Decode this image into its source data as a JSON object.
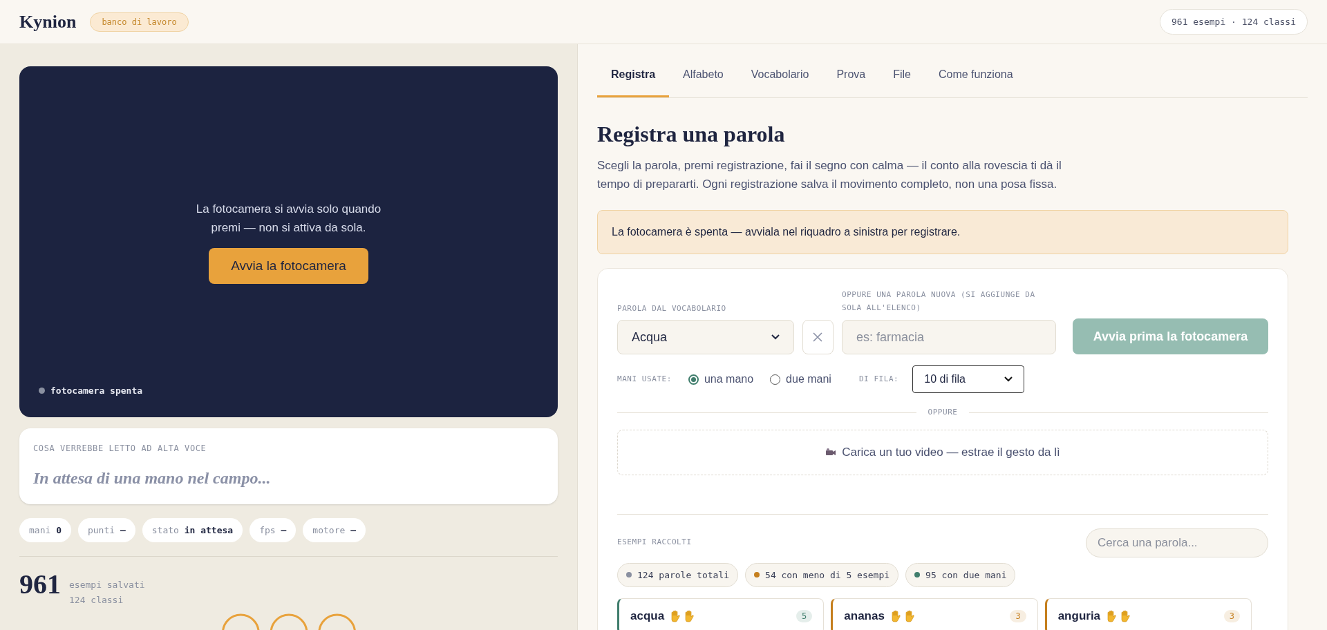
{
  "header": {
    "logo": "Kynion",
    "badge": "banco di lavoro",
    "summary": "961 esempi · 124 classi"
  },
  "camera": {
    "message": "La fotocamera si avvia solo quando premi — non si attiva da sola.",
    "button": "Avvia la fotocamera",
    "status": "fotocamera spenta",
    "on": false
  },
  "speech": {
    "label": "COSA VERREBBE LETTO AD ALTA VOCE",
    "text": "In attesa di una mano nel campo..."
  },
  "stats": [
    {
      "label": "mani",
      "value": "0"
    },
    {
      "label": "punti",
      "value": "—"
    },
    {
      "label": "stato",
      "value": "in attesa"
    },
    {
      "label": "fps",
      "value": "—"
    },
    {
      "label": "motore",
      "value": "—"
    }
  ],
  "totals": {
    "count": "961",
    "line_1": "esempi salvati",
    "line_2": "124 classi"
  },
  "tabs": [
    {
      "label": "Registra",
      "selected": true
    },
    {
      "label": "Alfabeto",
      "selected": false
    },
    {
      "label": "Vocabolario",
      "selected": false
    },
    {
      "label": "Prova",
      "selected": false
    },
    {
      "label": "File",
      "selected": false
    },
    {
      "label": "Come funziona",
      "selected": false
    }
  ],
  "page": {
    "title": "Registra una parola",
    "intro": "Scegli la parola, premi registrazione, fai il segno con calma — il conto alla rovescia ti dà il tempo di prepararti. Ogni registrazione salva il movimento completo, non una posa fissa.",
    "notice": "La fotocamera è spenta — avviala nel riquadro a sinistra per registrare."
  },
  "form": {
    "vocab_label": "PAROLA DAL VOCABOLARIO",
    "vocab_value": "Acqua",
    "new_label": "OPPURE UNA PAROLA NUOVA (SI AGGIUNGE DA SOLA ALL'ELENCO)",
    "new_placeholder": "es: farmacia",
    "record_button": "Avvia prima la fotocamera",
    "record_disabled": true,
    "hands_label": "MANI USATE:",
    "hands_options": [
      {
        "label": "una mano",
        "selected": true
      },
      {
        "label": "due mani",
        "selected": false
      }
    ],
    "repeat_label": "DI FILA:",
    "repeat_value": "10 di fila",
    "divider": "OPPURE",
    "upload": "Carica un tuo video — estrae il gesto da lì"
  },
  "examples": {
    "label": "ESEMPI RACCOLTI",
    "search_placeholder": "Cerca una parola...",
    "filters": [
      {
        "label": "124 parole totali",
        "color": "#8a90a0"
      },
      {
        "label": "54 con meno di 5 esempi",
        "color": "#c57f1e"
      },
      {
        "label": "95 con due mani",
        "color": "#3f7d6c"
      }
    ],
    "words": [
      {
        "name": "acqua",
        "two_hands": true,
        "count": "5",
        "color": "#3f7d6c"
      },
      {
        "name": "ananas",
        "two_hands": true,
        "count": "3",
        "color": "#c57f1e"
      },
      {
        "name": "anguria",
        "two_hands": true,
        "count": "3",
        "color": "#c57f1e"
      }
    ]
  }
}
